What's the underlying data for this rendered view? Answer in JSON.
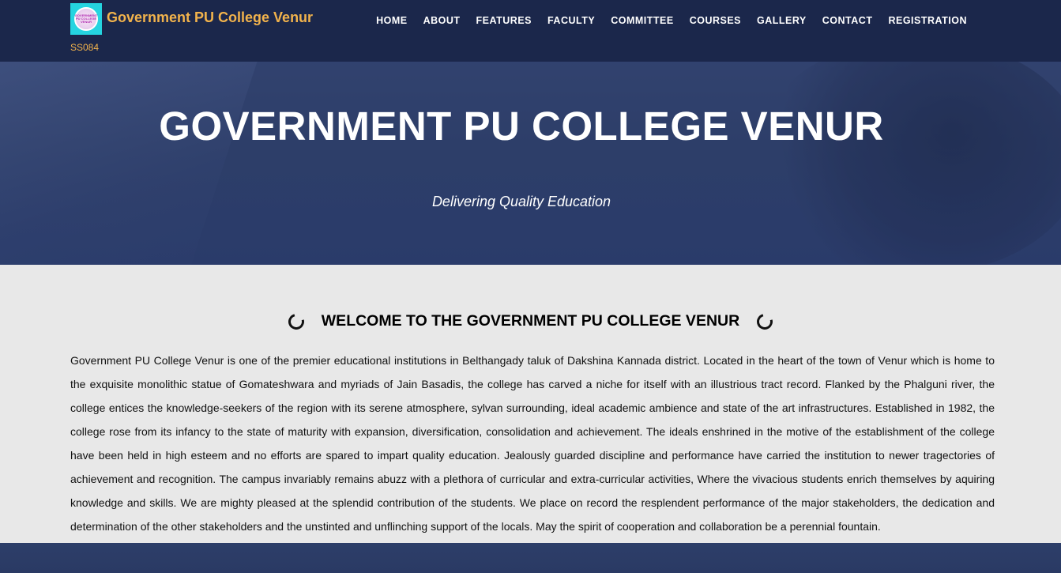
{
  "header": {
    "brand_name": "Government PU College Venur",
    "brand_code": "SS084",
    "logo_text": "GOVERNMENT\nPU COLLEGE\nVENUR"
  },
  "nav": {
    "items": [
      {
        "label": "HOME"
      },
      {
        "label": "ABOUT"
      },
      {
        "label": "FEATURES"
      },
      {
        "label": "FACULTY"
      },
      {
        "label": "COMMITTEE"
      },
      {
        "label": "COURSES"
      },
      {
        "label": "GALLERY"
      },
      {
        "label": "CONTACT"
      },
      {
        "label": "REGISTRATION"
      }
    ]
  },
  "hero": {
    "title": "GOVERNMENT PU COLLEGE VENUR",
    "subtitle": "Delivering Quality Education"
  },
  "welcome": {
    "heading": "WELCOME TO THE GOVERNMENT PU COLLEGE VENUR",
    "body": "Government PU College Venur is one of the premier educational institutions in Belthangady taluk of Dakshina Kannada district. Located in the heart of the town of Venur which is home to the exquisite monolithic statue of Gomateshwara and myriads of Jain Basadis, the college has carved a niche for itself with an illustrious tract record. Flanked by the Phalguni river, the college entices the knowledge-seekers of the region with its serene atmosphere, sylvan surrounding, ideal academic ambience and state of the art infrastructures. Established in 1982, the college rose from its infancy to the state of maturity with expansion, diversification, consolidation and achievement. The ideals enshrined in the motive of the establishment of the college have been held in high esteem and no efforts are spared to impart quality education. Jealously guarded discipline and performance have carried the institution to newer tragectories of achievement and recognition. The campus invariably remains abuzz with a plethora of curricular and extra-curricular activities, Where the vivacious students enrich themselves by aquiring knowledge and skills. We are mighty pleased at the splendid contribution of the students. We place on record the resplendent performance of the major stakeholders, the dedication and determination of the other stakeholders and the unstinted and unflinching support of the locals. May the spirit of cooperation and collaboration be a perennial fountain."
  },
  "colors": {
    "navbar_bg": "#1b274b",
    "brand_accent": "#f2b34c",
    "hero_bg": "#34466f",
    "content_bg": "#e8e8e8"
  },
  "icons": {
    "heading_left": "ring-icon",
    "heading_right": "ring-icon"
  }
}
